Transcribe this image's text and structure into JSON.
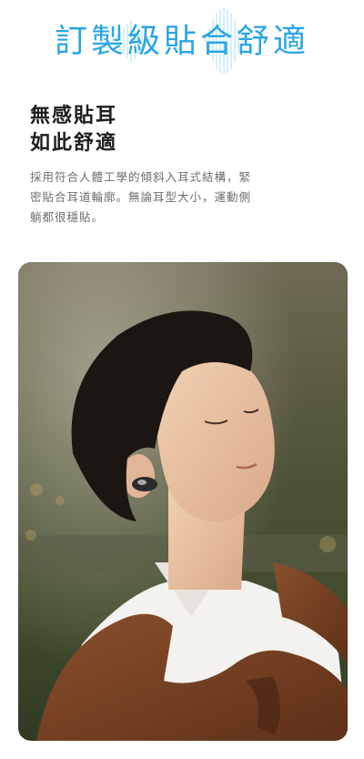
{
  "header": {
    "title": "訂製級貼合舒適"
  },
  "feature": {
    "heading_line1": "無感貼耳",
    "heading_line2": "如此舒適",
    "description": "採用符合人體工學的傾斜入耳式結構，緊密貼合耳道輪廓。無論耳型大小，運動側躺都很穩貼。"
  },
  "colors": {
    "accent": "#2aa6e3",
    "heading": "#1e1e1e",
    "body_text": "#6e6e6e"
  }
}
